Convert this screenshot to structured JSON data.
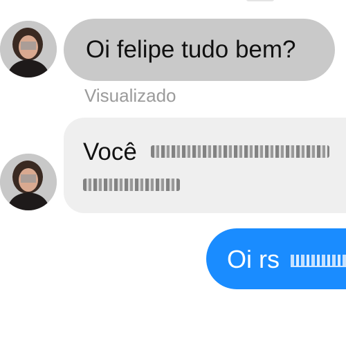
{
  "conversation": {
    "messages": [
      {
        "direction": "incoming",
        "text": "Oi felipe tudo bem?"
      },
      {
        "direction": "incoming",
        "text": "Você",
        "redacted": true
      },
      {
        "direction": "outgoing",
        "text": "Oi rs",
        "redacted": true
      }
    ],
    "seen_label": "Visualizado"
  },
  "colors": {
    "incoming_bubble": "#c9c9c9",
    "incoming_bubble_light": "#efefef",
    "outgoing_bubble": "#1a8cff",
    "seen_text": "#9b9b9b"
  },
  "icons": {
    "contact_avatar": "profile-photo"
  }
}
